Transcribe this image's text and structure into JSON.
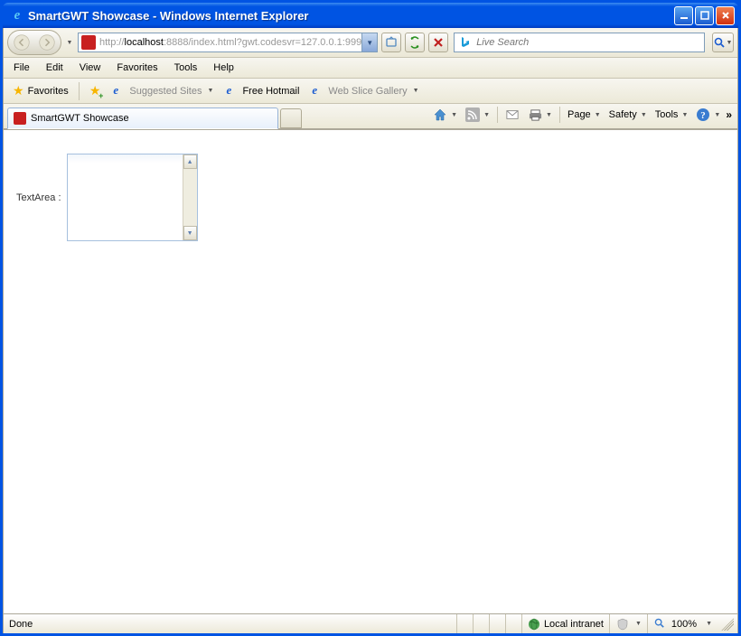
{
  "window": {
    "title": "SmartGWT Showcase - Windows Internet Explorer"
  },
  "address": {
    "prefix": "http://",
    "host": "localhost",
    "rest": ":8888/index.html?gwt.codesvr=127.0.0.1:999"
  },
  "search": {
    "placeholder": "Live Search"
  },
  "menu": {
    "file": "File",
    "edit": "Edit",
    "view": "View",
    "favorites": "Favorites",
    "tools": "Tools",
    "help": "Help"
  },
  "favbar": {
    "favorites": "Favorites",
    "suggested": "Suggested Sites",
    "hotmail": "Free Hotmail",
    "webslice": "Web Slice Gallery"
  },
  "tab": {
    "title": "SmartGWT Showcase"
  },
  "commands": {
    "page": "Page",
    "safety": "Safety",
    "tools": "Tools"
  },
  "content": {
    "textarea_label": "TextArea :"
  },
  "status": {
    "left": "Done",
    "zone": "Local intranet",
    "zoom": "100%"
  }
}
